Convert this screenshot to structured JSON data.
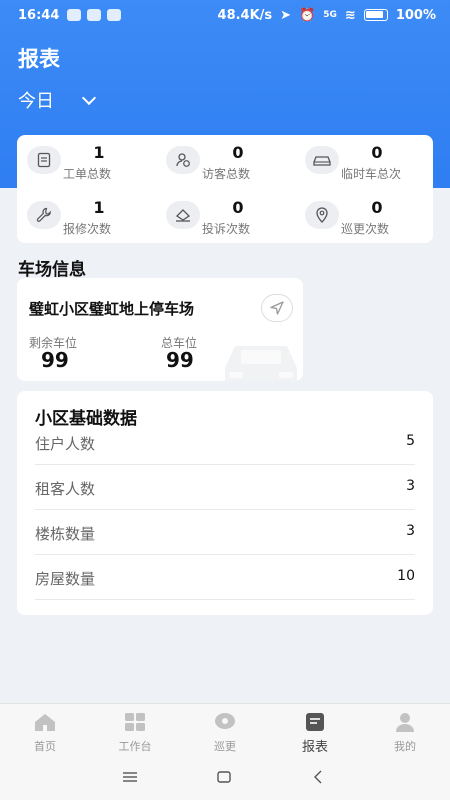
{
  "status_bar": {
    "time": "16:44",
    "net_speed": "48.4K/s",
    "network": "5G",
    "battery": "100%"
  },
  "colors": {
    "primary": "#2f7ef2",
    "background": "#eef1f5"
  },
  "header": {
    "title": "报表",
    "date_filter": "今日"
  },
  "stats": [
    {
      "icon": "work-order-icon",
      "value": "1",
      "label": "工单总数"
    },
    {
      "icon": "visitor-icon",
      "value": "0",
      "label": "访客总数"
    },
    {
      "icon": "car-icon",
      "value": "0",
      "label": "临时车总次"
    },
    {
      "icon": "wrench-icon",
      "value": "1",
      "label": "报修次数"
    },
    {
      "icon": "complaint-icon",
      "value": "0",
      "label": "投诉次数"
    },
    {
      "icon": "location-pin-icon",
      "value": "0",
      "label": "巡更次数"
    }
  ],
  "parking": {
    "section_title": "车场信息",
    "name": "璧虹小区璧虹地上停车场",
    "remaining_label": "剩余车位",
    "remaining_value": "99",
    "total_label": "总车位",
    "total_value": "99"
  },
  "basic": {
    "title": "小区基础数据",
    "rows": [
      {
        "label": "住户人数",
        "value": "5"
      },
      {
        "label": "租客人数",
        "value": "3"
      },
      {
        "label": "楼栋数量",
        "value": "3"
      },
      {
        "label": "房屋数量",
        "value": "10"
      }
    ]
  },
  "tabs": [
    {
      "icon": "home-icon",
      "label": "首页"
    },
    {
      "icon": "grid-icon",
      "label": "工作台"
    },
    {
      "icon": "patrol-icon",
      "label": "巡更"
    },
    {
      "icon": "report-icon",
      "label": "报表",
      "active": true
    },
    {
      "icon": "user-icon",
      "label": "我的"
    }
  ]
}
